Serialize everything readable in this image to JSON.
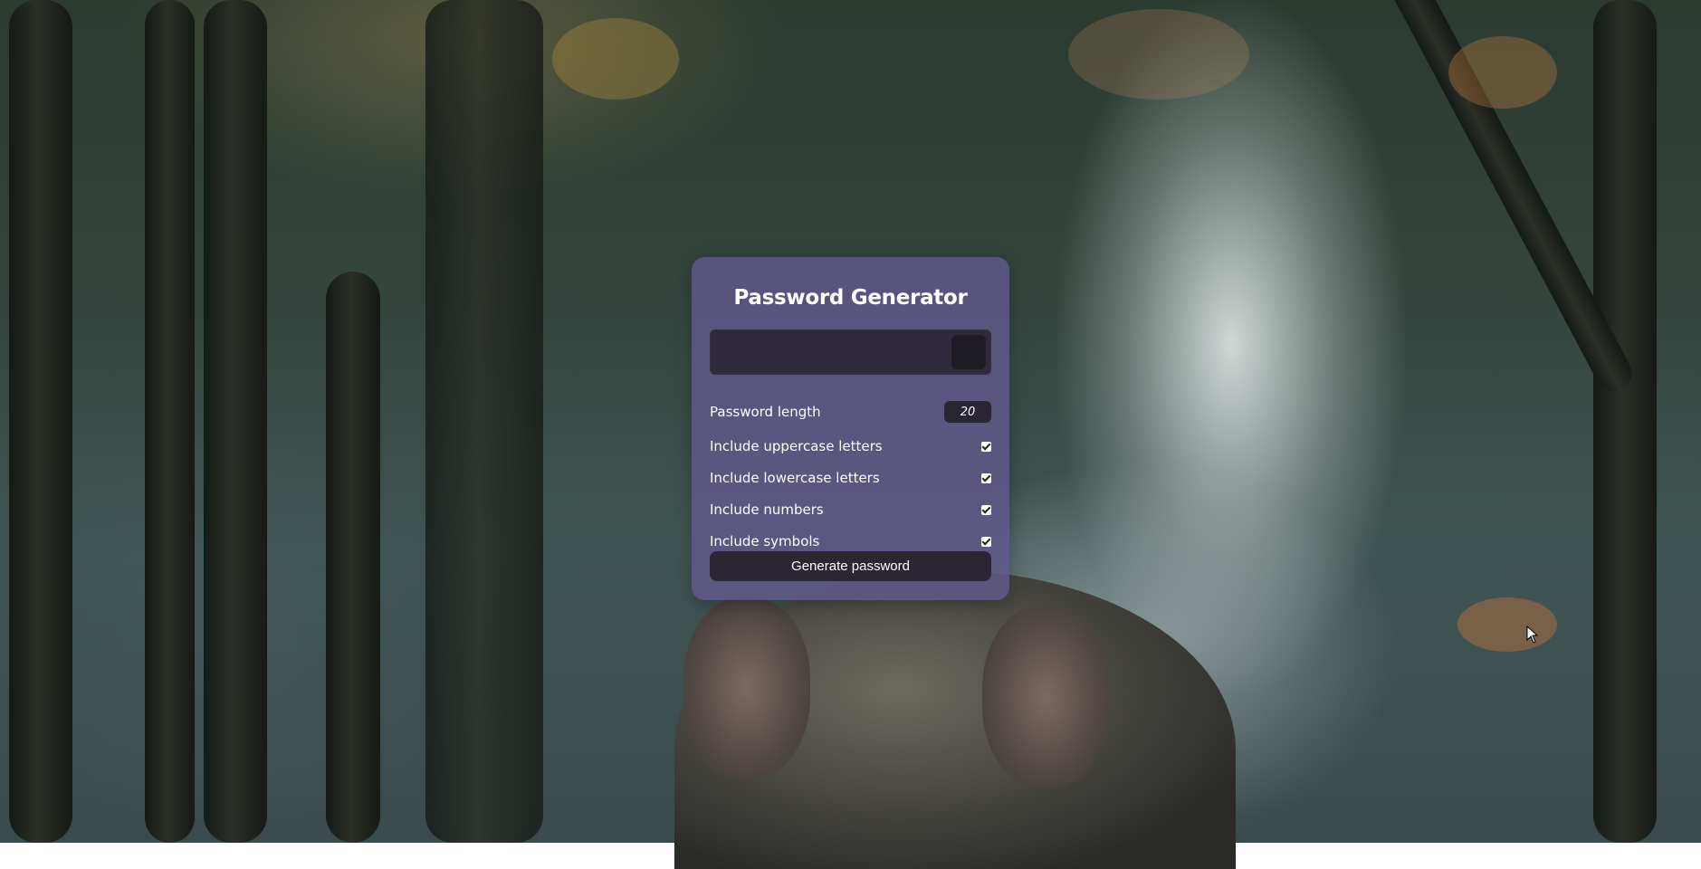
{
  "app": {
    "title": "Password Generator"
  },
  "result": {
    "value": ""
  },
  "options": {
    "length_label": "Password length",
    "length_value": "20",
    "uppercase_label": "Include uppercase letters",
    "uppercase_checked": true,
    "lowercase_label": "Include lowercase letters",
    "lowercase_checked": true,
    "numbers_label": "Include numbers",
    "numbers_checked": true,
    "symbols_label": "Include symbols",
    "symbols_checked": true
  },
  "actions": {
    "generate_label": "Generate password",
    "copy_icon": "clipboard-icon"
  },
  "colors": {
    "panel": "#60588c",
    "field": "#2f2a3c",
    "button": "#2b2632"
  }
}
